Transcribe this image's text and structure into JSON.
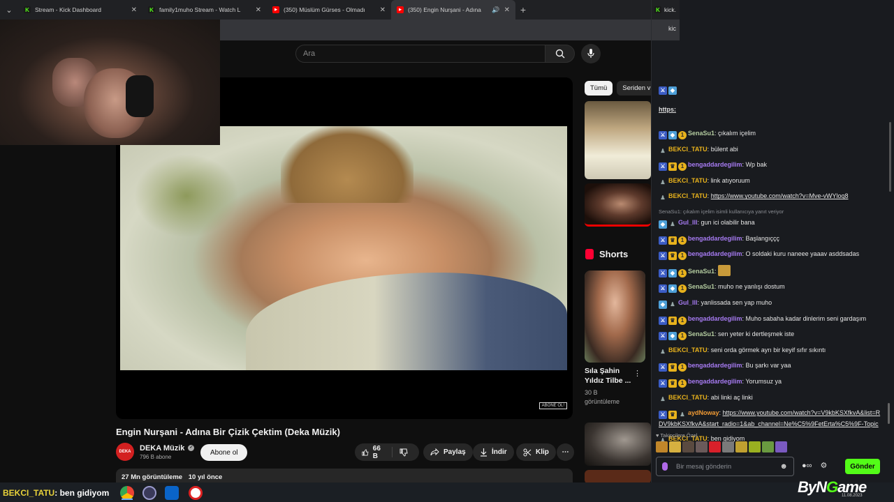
{
  "browser": {
    "tabs": [
      {
        "label": "Stream - Kick Dashboard",
        "favicon": "kick"
      },
      {
        "label": "family1muho Stream - Watch L",
        "favicon": "kick"
      },
      {
        "label": "(350) Müslüm Gürses - Olmadı",
        "favicon": "youtube"
      },
      {
        "label": "(350) Engin Nurşani - Adına",
        "favicon": "youtube",
        "active": true
      }
    ],
    "chat_tab_label": "kick.",
    "chat_addr_label": "kic"
  },
  "youtube": {
    "search_placeholder": "Ara",
    "video_watermark": "ABONE OL!",
    "video_title": "Engin Nurşani - Adına Bir Çizik Çektim (Deka Müzik)",
    "channel_avatar_text": "DEKA",
    "channel_name": "DEKA Müzik",
    "subscribers": "796 B abone",
    "subscribe_label": "Abone ol",
    "likes": "66 B",
    "share_label": "Paylaş",
    "download_label": "İndir",
    "clip_label": "Klip",
    "views": "27 Mn görüntüleme",
    "age": "10 yıl önce",
    "chips": [
      "Tümü",
      "Seriden vi"
    ],
    "shorts_header": "Shorts",
    "short_title": "Sıla Şahin Yıldız Tilbe ...",
    "short_views": "30 B görüntüleme"
  },
  "chat": {
    "pinned_link": "https:",
    "messages": [
      {
        "badges": [
          "mod",
          "vip",
          "sub"
        ],
        "user": "SenaSu1",
        "color": "green",
        "text": "çıkalım içelim"
      },
      {
        "badges": [
          "ghost"
        ],
        "user": "BEKCI_TATU",
        "color": "gold",
        "text": "bülent abi"
      },
      {
        "badges": [
          "mod",
          "crown",
          "sub"
        ],
        "user": "bengaddardegilim",
        "color": "purple",
        "text": "Wp bak"
      },
      {
        "badges": [
          "ghost"
        ],
        "user": "BEKCI_TATU",
        "color": "gold",
        "text": "link atıyoruum"
      },
      {
        "badges": [
          "ghost"
        ],
        "user": "BEKCI_TATU",
        "color": "gold",
        "text": "https://www.youtube.com/watch?v=Mve-vWYloq8",
        "link": true
      },
      {
        "reply": "SenaSu1: çıkalım içelim isimli kullanıcıya yanıt veriyor"
      },
      {
        "badges": [
          "vip",
          "ghost"
        ],
        "user": "Gul_lll",
        "color": "purple",
        "text": "gun ici olabilir bana"
      },
      {
        "badges": [
          "mod",
          "crown",
          "sub"
        ],
        "user": "bengaddardegilim",
        "color": "purple",
        "text": "Başlangıççç"
      },
      {
        "badges": [
          "mod",
          "crown",
          "sub"
        ],
        "user": "bengaddardegilim",
        "color": "purple",
        "text": "O soldaki kuru naneee yaaav asddsadas"
      },
      {
        "badges": [
          "mod",
          "vip",
          "sub"
        ],
        "user": "SenaSu1",
        "color": "green",
        "text": "",
        "emote": true
      },
      {
        "badges": [
          "mod",
          "vip",
          "sub"
        ],
        "user": "SenaSu1",
        "color": "green",
        "text": "muho ne yanlışı dostum"
      },
      {
        "badges": [
          "vip",
          "ghost"
        ],
        "user": "Gul_lll",
        "color": "purple",
        "text": "yanlissada sen yap muho"
      },
      {
        "badges": [
          "mod",
          "crown",
          "sub"
        ],
        "user": "bengaddardegilim",
        "color": "purple",
        "text": "Muho sabaha kadar dinlerim seni gardaşım"
      },
      {
        "badges": [
          "mod",
          "vip",
          "sub"
        ],
        "user": "SenaSu1",
        "color": "green",
        "text": "sen yeter ki dertleşmek iste"
      },
      {
        "badges": [
          "ghost"
        ],
        "user": "BEKCI_TATU",
        "color": "gold",
        "text": "seni orda görmek ayrı bir keyif sıfır sıkıntı"
      },
      {
        "badges": [
          "mod",
          "crown",
          "sub"
        ],
        "user": "bengaddardegilim",
        "color": "purple",
        "text": "Bu şarkı var yaa"
      },
      {
        "badges": [
          "mod",
          "crown",
          "sub"
        ],
        "user": "bengaddardegilim",
        "color": "purple",
        "text": "Yorumsuz ya"
      },
      {
        "badges": [
          "ghost"
        ],
        "user": "BEKCI_TATU",
        "color": "gold",
        "text": "abi linki aç linki"
      },
      {
        "badges": [
          "mod",
          "crown",
          "ghost"
        ],
        "user": "aydNoway",
        "color": "orange",
        "text": "https://www.youtube.com/watch?v=V9kbKSXfkvA&list=RDV9kbKSXfkvA&start_radio=1&ab_channel=Ne%C5%9FetErta%C5%9F-Topic",
        "link": true
      },
      {
        "badges": [
          "ghost"
        ],
        "user": "BEKCI_TATU",
        "color": "gold",
        "text": "ben gidiyom"
      }
    ],
    "followers_label": "Takipçilere Özel",
    "input_placeholder": "Bir mesaj gönderin",
    "send_label": "Gönder"
  },
  "overlay": {
    "ticker_user": "BEKCI_TATU",
    "ticker_text": ": ben gidiyom",
    "brand_1": "ByN",
    "brand_2": "G",
    "brand_3": "ame",
    "brand_date": "11.08.2023"
  },
  "colors": {
    "kick_green": "#53fc18",
    "youtube_red": "#ff0000",
    "chat_bg": "#191b1f",
    "username_gold": "#e8b21c",
    "username_purple": "#a77bf3"
  }
}
